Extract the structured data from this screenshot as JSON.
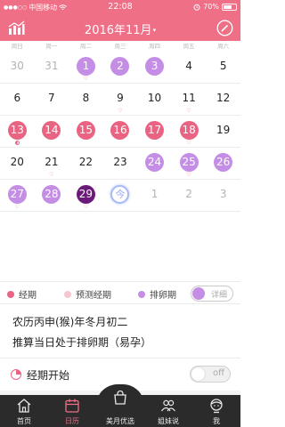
{
  "status_bar": {
    "signal": "●●●○○",
    "carrier": "中国移动",
    "time": "22:08",
    "battery": "70%",
    "battery_level": 0.7
  },
  "nav": {
    "title": "2016年11月",
    "caret": "▾"
  },
  "weekdays": [
    "周日",
    "周一",
    "周二",
    "周三",
    "周四",
    "周五",
    "周六"
  ],
  "calendar": [
    [
      {
        "d": "30",
        "s": "gray"
      },
      {
        "d": "31",
        "s": "gray"
      },
      {
        "d": "1",
        "s": "ovu",
        "m": "heart"
      },
      {
        "d": "2",
        "s": "ovu"
      },
      {
        "d": "3",
        "s": "ovu"
      },
      {
        "d": "4",
        "s": ""
      },
      {
        "d": "5",
        "s": ""
      }
    ],
    [
      {
        "d": "6",
        "s": ""
      },
      {
        "d": "7",
        "s": ""
      },
      {
        "d": "8",
        "s": ""
      },
      {
        "d": "9",
        "s": "",
        "m": "heart"
      },
      {
        "d": "10",
        "s": ""
      },
      {
        "d": "11",
        "s": "",
        "m": "heart"
      },
      {
        "d": "12",
        "s": ""
      }
    ],
    [
      {
        "d": "13",
        "s": "period",
        "m": "half"
      },
      {
        "d": "14",
        "s": "period"
      },
      {
        "d": "15",
        "s": "period"
      },
      {
        "d": "16",
        "s": "period"
      },
      {
        "d": "17",
        "s": "period"
      },
      {
        "d": "18",
        "s": "period",
        "m": "heart"
      },
      {
        "d": "19",
        "s": ""
      }
    ],
    [
      {
        "d": "20",
        "s": ""
      },
      {
        "d": "21",
        "s": "",
        "m": "heart"
      },
      {
        "d": "22",
        "s": ""
      },
      {
        "d": "23",
        "s": ""
      },
      {
        "d": "24",
        "s": "fert"
      },
      {
        "d": "25",
        "s": "fert",
        "m": "heart"
      },
      {
        "d": "26",
        "s": "fert"
      }
    ],
    [
      {
        "d": "27",
        "s": "fert",
        "m": "heart"
      },
      {
        "d": "28",
        "s": "fert"
      },
      {
        "d": "29",
        "s": "dark",
        "m": "heart"
      },
      {
        "d": "今",
        "s": "today"
      },
      {
        "d": "1",
        "s": "gray"
      },
      {
        "d": "2",
        "s": "gray"
      },
      {
        "d": "3",
        "s": "gray"
      }
    ]
  ],
  "legend": {
    "items": [
      {
        "label": "经期",
        "color": "#e86482"
      },
      {
        "label": "预测经期",
        "color": "#f6c6d0"
      },
      {
        "label": "排卵期",
        "color": "#c48de6"
      }
    ],
    "toggle_label": "详细"
  },
  "info": {
    "lunar": "农历丙申(猴)年冬月初二",
    "predict": "推算当日处于排卵期（易孕）"
  },
  "period_start": {
    "label": "经期开始",
    "toggle_label": "off"
  },
  "tabs": [
    {
      "label": "首页",
      "icon": "home-icon",
      "active": false
    },
    {
      "label": "日历",
      "icon": "calendar-icon",
      "active": true
    },
    {
      "label": "美月优选",
      "icon": "shopping-bag-icon",
      "active": false
    },
    {
      "label": "姐妹说",
      "icon": "chat-icon",
      "active": false
    },
    {
      "label": "我",
      "icon": "profile-icon",
      "active": false
    }
  ]
}
